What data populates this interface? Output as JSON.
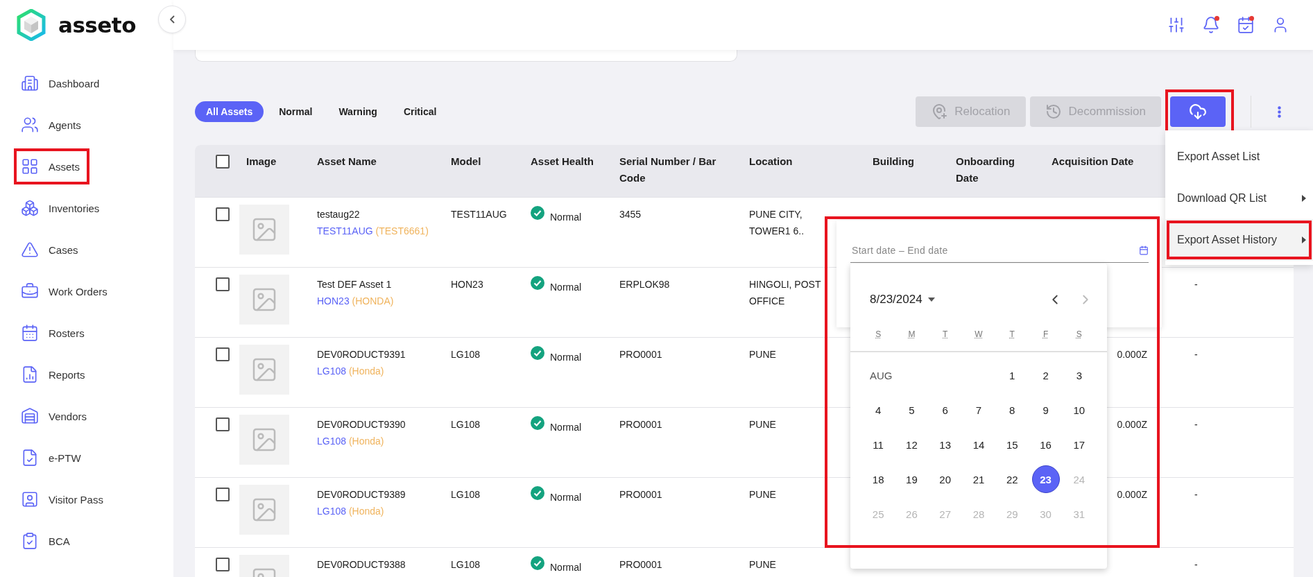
{
  "brand": {
    "name": "asseto"
  },
  "sidebar": {
    "items": [
      {
        "label": "Dashboard",
        "highlighted": false
      },
      {
        "label": "Agents",
        "highlighted": false
      },
      {
        "label": "Assets",
        "highlighted": true
      },
      {
        "label": "Inventories",
        "highlighted": false
      },
      {
        "label": "Cases",
        "highlighted": false
      },
      {
        "label": "Work Orders",
        "highlighted": false
      },
      {
        "label": "Rosters",
        "highlighted": false
      },
      {
        "label": "Reports",
        "highlighted": false
      },
      {
        "label": "Vendors",
        "highlighted": false
      },
      {
        "label": "e-PTW",
        "highlighted": false
      },
      {
        "label": "Visitor Pass",
        "highlighted": false
      },
      {
        "label": "BCA",
        "highlighted": false
      }
    ]
  },
  "topbar": {
    "notifications": [
      {
        "kind": "filters",
        "unread": false
      },
      {
        "kind": "alerts",
        "unread": true
      },
      {
        "kind": "tasks",
        "unread": true
      },
      {
        "kind": "profile",
        "unread": false
      }
    ]
  },
  "filters": [
    {
      "label": "All Assets",
      "selected": true
    },
    {
      "label": "Normal",
      "selected": false
    },
    {
      "label": "Warning",
      "selected": false
    },
    {
      "label": "Critical",
      "selected": false
    }
  ],
  "actions": [
    {
      "kind": "relocation",
      "label": "Relocation",
      "disabled": true
    },
    {
      "kind": "decommission",
      "label": "Decommission",
      "disabled": true
    }
  ],
  "download": {
    "highlighted": true
  },
  "table": {
    "select_all": {
      "checked": false
    },
    "columns": [
      "Image",
      "Asset Name",
      "Model",
      "Asset Health",
      "Serial Number / Bar Code",
      "Location",
      "Building",
      "Onboarding Date",
      "Acquisition Date"
    ],
    "rows": [
      {
        "checked": false,
        "name": "testaug22",
        "code": "TEST11AUG",
        "brand": "(TEST6661)",
        "model": "TEST11AUG",
        "health": "Normal",
        "serial": "3455",
        "location": "PUNE CITY, TOWER1 6.."
      },
      {
        "checked": false,
        "name": "Test DEF Asset 1",
        "code": "HON23",
        "brand": "(HONDA)",
        "model": "HON23",
        "health": "Normal",
        "serial": "ERPLOK98",
        "location": "HINGOLI, POST OFFICE",
        "column_10": "-"
      },
      {
        "checked": false,
        "name": "DEV0RODUCT9391",
        "code": "LG108",
        "brand": "(Honda)",
        "model": "LG108",
        "health": "Normal",
        "serial": "PRO0001",
        "location": "PUNE",
        "acquisition": "0.000Z",
        "column_10": "-"
      },
      {
        "checked": false,
        "name": "DEV0RODUCT9390",
        "code": "LG108",
        "brand": "(Honda)",
        "model": "LG108",
        "health": "Normal",
        "serial": "PRO0001",
        "location": "PUNE",
        "acquisition": "0.000Z",
        "column_10": "-"
      },
      {
        "checked": false,
        "name": "DEV0RODUCT9389",
        "code": "LG108",
        "brand": "(Honda)",
        "model": "LG108",
        "health": "Normal",
        "serial": "PRO0001",
        "location": "PUNE",
        "acquisition": "0.000Z",
        "column_10": "-"
      },
      {
        "checked": false,
        "name": "DEV0RODUCT9388",
        "model": "LG108",
        "health": "Normal",
        "serial": "PRO0001",
        "location": "PUNE",
        "column_10": "-"
      }
    ]
  },
  "export_menu": {
    "items": [
      {
        "label": "Export Asset List",
        "submenu": false,
        "selected": false,
        "highlighted": false
      },
      {
        "label": "Download QR List",
        "submenu": true,
        "selected": false,
        "highlighted": false
      },
      {
        "label": "Export Asset History",
        "submenu": true,
        "selected": true,
        "highlighted": true
      }
    ]
  },
  "date_range": {
    "placeholder": "Start date – End date",
    "highlighted": true,
    "calendar": {
      "title": "8/23/2024",
      "month_label": "AUG",
      "weekdays": [
        "S",
        "M",
        "T",
        "W",
        "T",
        "F",
        "S"
      ],
      "weeks": [
        [
          {
            "label": "1",
            "selected": false,
            "disabled": false
          },
          {
            "label": "2",
            "selected": false,
            "disabled": false
          },
          {
            "label": "3",
            "selected": false,
            "disabled": false
          }
        ],
        [
          {
            "label": "4",
            "selected": false,
            "disabled": false
          },
          {
            "label": "5",
            "selected": false,
            "disabled": false
          },
          {
            "label": "6",
            "selected": false,
            "disabled": false
          },
          {
            "label": "7",
            "selected": false,
            "disabled": false
          },
          {
            "label": "8",
            "selected": false,
            "disabled": false
          },
          {
            "label": "9",
            "selected": false,
            "disabled": false
          },
          {
            "label": "10",
            "selected": false,
            "disabled": false
          }
        ],
        [
          {
            "label": "11",
            "selected": false,
            "disabled": false
          },
          {
            "label": "12",
            "selected": false,
            "disabled": false
          },
          {
            "label": "13",
            "selected": false,
            "disabled": false
          },
          {
            "label": "14",
            "selected": false,
            "disabled": false
          },
          {
            "label": "15",
            "selected": false,
            "disabled": false
          },
          {
            "label": "16",
            "selected": false,
            "disabled": false
          },
          {
            "label": "17",
            "selected": false,
            "disabled": false
          }
        ],
        [
          {
            "label": "18",
            "selected": false,
            "disabled": false
          },
          {
            "label": "19",
            "selected": false,
            "disabled": false
          },
          {
            "label": "20",
            "selected": false,
            "disabled": false
          },
          {
            "label": "21",
            "selected": false,
            "disabled": false
          },
          {
            "label": "22",
            "selected": false,
            "disabled": false
          },
          {
            "label": "23",
            "selected": true,
            "disabled": false
          },
          {
            "label": "24",
            "selected": false,
            "disabled": true
          }
        ],
        [
          {
            "label": "25",
            "selected": false,
            "disabled": true
          },
          {
            "label": "26",
            "selected": false,
            "disabled": true
          },
          {
            "label": "27",
            "selected": false,
            "disabled": true
          },
          {
            "label": "28",
            "selected": false,
            "disabled": true
          },
          {
            "label": "29",
            "selected": false,
            "disabled": true
          },
          {
            "label": "30",
            "selected": false,
            "disabled": true
          },
          {
            "label": "31",
            "selected": false,
            "disabled": true
          }
        ]
      ]
    }
  }
}
